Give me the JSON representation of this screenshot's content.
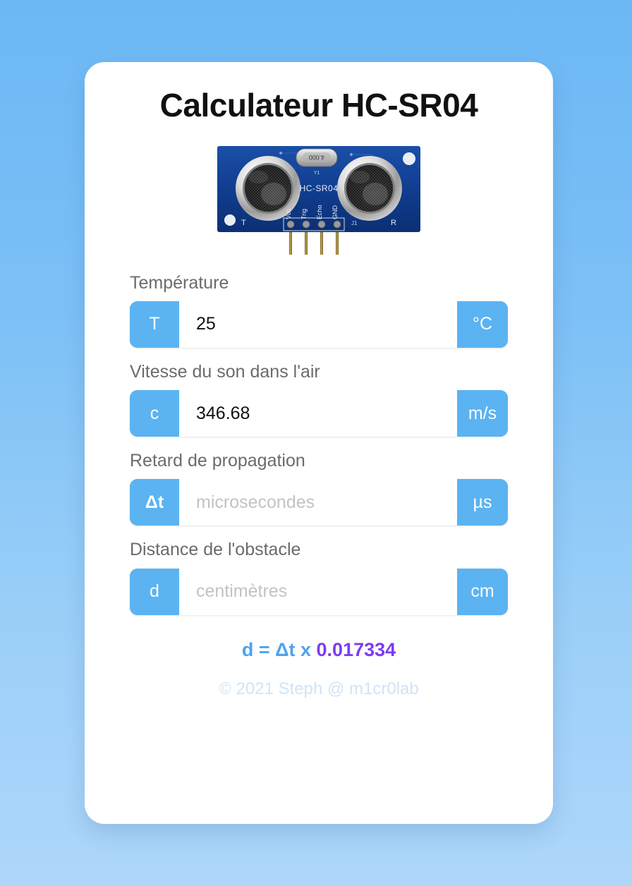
{
  "page": {
    "background_top": "#6cb8f5",
    "background_bottom": "#aed6fa",
    "accent": "#5bb3f2",
    "accent_value": "#7c3cf0"
  },
  "card": {
    "title": "Calculateur HC-SR04"
  },
  "sensor": {
    "name": "hc-sr04-ultrasonic-sensor",
    "board_label": "HC-SR04",
    "crystal_label": "4.000",
    "crystal_ref": "Y1",
    "transmitter_mark": "T",
    "receiver_mark": "R",
    "header_ref": "J1",
    "pins": [
      "Vcc",
      "Trig",
      "Echo",
      "GND"
    ]
  },
  "fields": [
    {
      "key": "temperature",
      "label": "Température",
      "prefix": "T",
      "suffix": "°C",
      "value": "25",
      "placeholder": ""
    },
    {
      "key": "sound_speed",
      "label": "Vitesse du son dans l'air",
      "prefix": "c",
      "suffix": "m/s",
      "value": "346.68",
      "placeholder": ""
    },
    {
      "key": "propagation_delay",
      "label": "Retard de propagation",
      "prefix": "Δt",
      "suffix": "µs",
      "value": "",
      "placeholder": "microsecondes"
    },
    {
      "key": "distance",
      "label": "Distance de l'obstacle",
      "prefix": "d",
      "suffix": "cm",
      "value": "",
      "placeholder": "centimètres"
    }
  ],
  "formula": {
    "expression": "d = Δt x ",
    "coefficient": "0.017334"
  },
  "footer": {
    "text": "© 2021 Steph @ m1cr0lab"
  }
}
